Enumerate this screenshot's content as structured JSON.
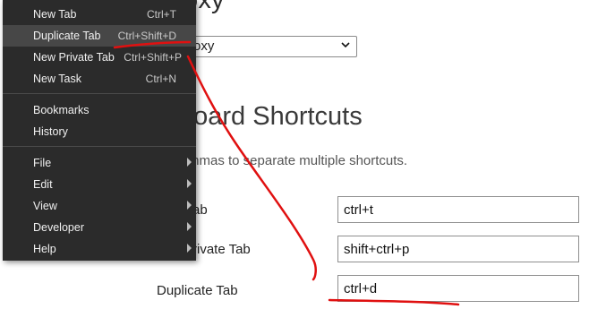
{
  "page": {
    "proxy_heading": "oxy",
    "proxy_select_value": "oxy",
    "shortcuts_heading": "board Shortcuts",
    "shortcuts_hint": "mmas to separate multiple shortcuts.",
    "rows": [
      {
        "label": "ab",
        "value": "ctrl+t"
      },
      {
        "label": "rivate Tab",
        "value": "shift+ctrl+p"
      },
      {
        "label": "Duplicate Tab",
        "value": "ctrl+d"
      }
    ]
  },
  "menu": {
    "items": [
      {
        "label": "New Tab",
        "shortcut": "Ctrl+T"
      },
      {
        "label": "Duplicate Tab",
        "shortcut": "Ctrl+Shift+D",
        "highlighted": true
      },
      {
        "label": "New Private Tab",
        "shortcut": "Ctrl+Shift+P"
      },
      {
        "label": "New Task",
        "shortcut": "Ctrl+N"
      },
      {
        "label": "Bookmarks",
        "shortcut": ""
      },
      {
        "label": "History",
        "shortcut": ""
      },
      {
        "label": "File",
        "submenu": true
      },
      {
        "label": "Edit",
        "submenu": true
      },
      {
        "label": "View",
        "submenu": true
      },
      {
        "label": "Developer",
        "submenu": true
      },
      {
        "label": "Help",
        "submenu": true
      }
    ]
  },
  "colors": {
    "menu_bg": "#2b2b2b",
    "menu_highlight": "#474747",
    "annotation": "#e01010"
  },
  "icons": {
    "select_arrow": "chevron-down-icon",
    "submenu_arrow": "chevron-right-icon"
  }
}
